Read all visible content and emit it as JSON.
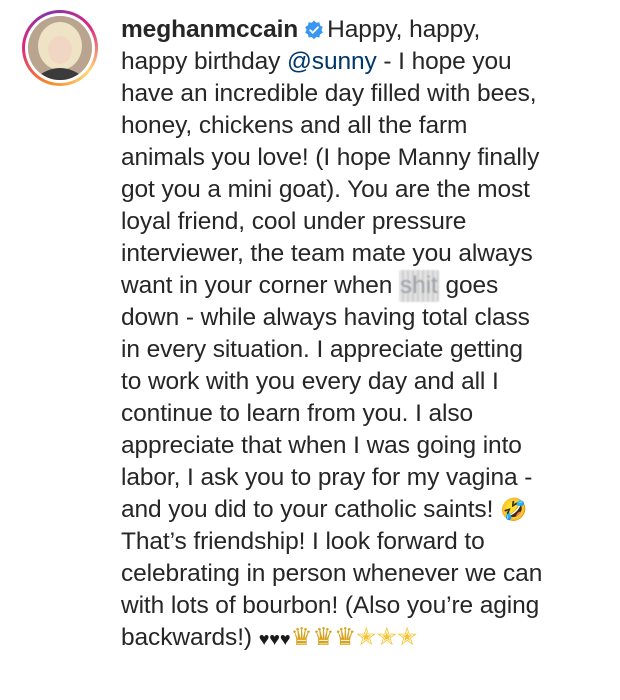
{
  "post": {
    "username": "meghanmccain",
    "verified_icon": "verified-badge-icon",
    "caption_lines": [
      "Happy, happy,",
      "happy birthday ",
      "@sunny",
      " - I hope you",
      "have an incredible day filled with bees,",
      "honey, chickens and all the farm",
      "animals you love! (I hope Manny finally",
      "got you a mini goat). You are the most",
      "loyal friend, cool under pressure",
      "interviewer, the team mate you always",
      "want in your corner when ",
      "shit",
      " goes",
      "down - while always having total class",
      "in every situation. I appreciate getting",
      "to work with you every day and all I",
      "continue to learn from you. I also",
      "appreciate that when I was going into",
      "labor, I ask you to pray for my vagina -",
      "and you did to your catholic saints! ",
      "🤣",
      "That’s friendship! I look forward to",
      "celebrating in person whenever we can",
      "with lots of bourbon! (Also you’re aging",
      "backwards!) ",
      "♥♥♥",
      "♛♛♛",
      "✭✭✭"
    ],
    "colors": {
      "text": "#262626",
      "mention": "#00376b",
      "verified": "#3897f0"
    }
  }
}
